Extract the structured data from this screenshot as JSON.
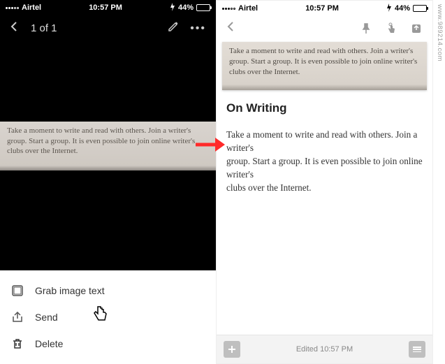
{
  "status": {
    "carrier": "Airtel",
    "time": "10:57 PM",
    "battery_percent": "44%",
    "charging_icon": "charging-icon"
  },
  "left": {
    "title": "1 of 1",
    "scanned_text": "Take a moment to write and read with others. Join a writer's group. Start a group. It is even possible to join online writer's clubs over the Internet.",
    "sheet": {
      "grab": "Grab image text",
      "send": "Send",
      "delete": "Delete"
    }
  },
  "right": {
    "scanned_text": "Take a moment to write and read with others. Join a writer's group. Start a group. It is even possible to join online writer's clubs over the Internet.",
    "title": "On Writing",
    "body_line1": "Take a moment to write and read with others. Join a writer's",
    "body_line2": "group. Start a group. It is even possible to join online writer's",
    "body_line3": "clubs over the Internet.",
    "edited": "Edited 10:57 PM"
  },
  "watermark": "www.989214.com"
}
